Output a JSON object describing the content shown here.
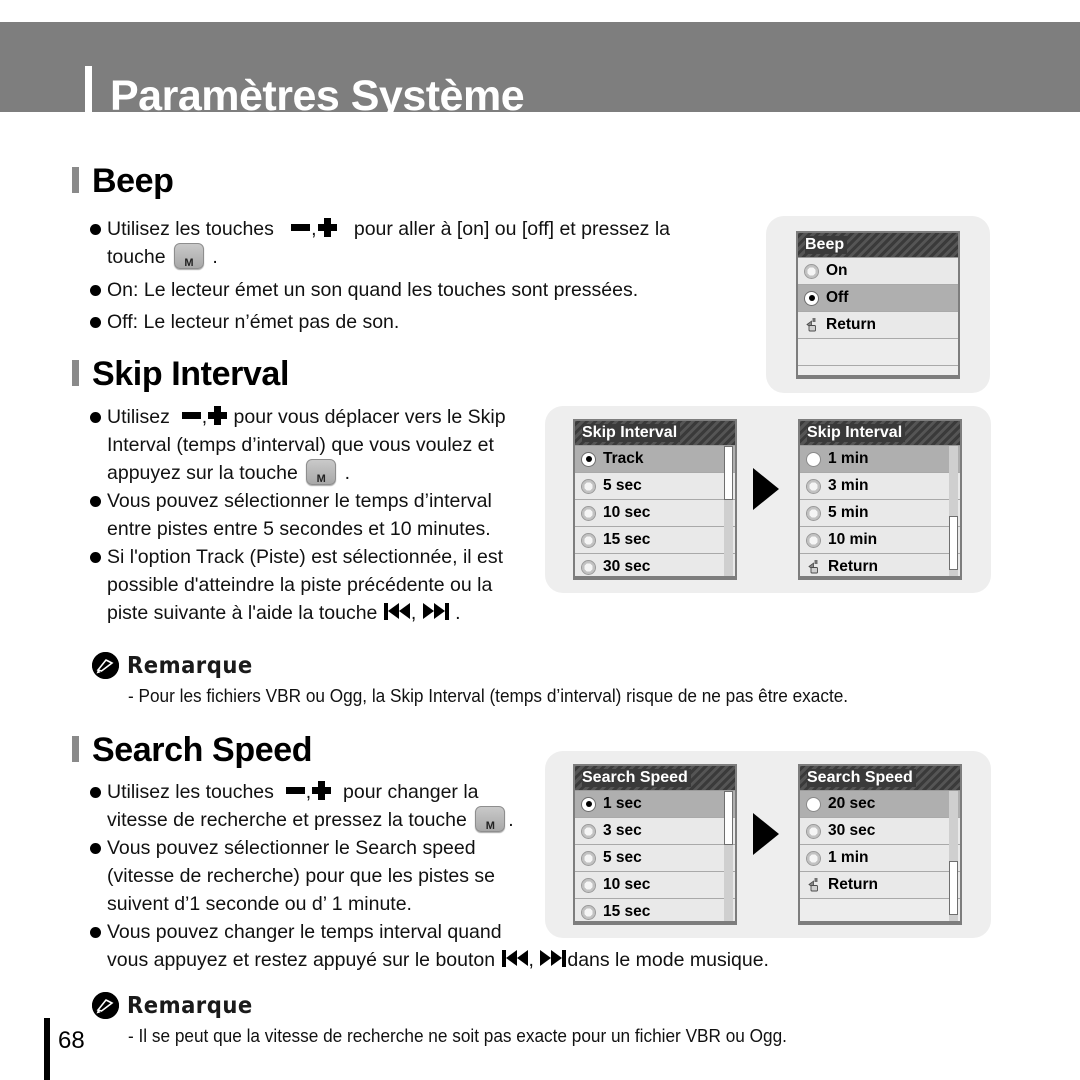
{
  "header": {
    "title": "Paramètres Système"
  },
  "sections": {
    "beep": {
      "heading": "Beep",
      "bullets": [
        {
          "pre": "Utilisez les touches",
          "mid": "pour aller à [on] ou [off] et pressez la",
          "post": "touche",
          "tail": "."
        },
        {
          "text": "On: Le lecteur émet un son quand les touches sont pressées."
        },
        {
          "text": "Off: Le lecteur n’émet pas de son."
        }
      ]
    },
    "skip_interval": {
      "heading": "Skip Interval",
      "bullets": [
        {
          "pre": "Utilisez",
          "mid": "pour vous déplacer vers le Skip",
          "line2": "Interval (temps d’interval) que vous voulez et",
          "line3pre": "appuyez sur la touche",
          "line3post": "."
        },
        {
          "text": "Vous pouvez sélectionner le temps d’interval",
          "line2": "entre pistes entre 5 secondes et 10 minutes."
        },
        {
          "text": "Si l'option Track (Piste) est sélectionnée, il est",
          "line2": "possible d'atteindre la piste précédente ou la",
          "line3pre": "piste suivante à l'aide la touche",
          "line3post": "."
        }
      ]
    },
    "search_speed": {
      "heading": "Search Speed",
      "bullets": [
        {
          "pre": "Utilisez les touches",
          "mid": "pour changer la",
          "line2pre": "vitesse de recherche et pressez la touche",
          "line2post": "."
        },
        {
          "text": "Vous pouvez sélectionner le Search speed",
          "line2": "(vitesse de recherche) pour que les pistes se",
          "line3": "suivent d’1 seconde ou d’ 1 minute."
        },
        {
          "text": "Vous pouvez changer le temps interval quand",
          "line2pre": "vous appuyez et restez appuyé sur le bouton",
          "line2post": "dans le mode musique."
        }
      ]
    }
  },
  "notes": [
    {
      "label": "Remarque",
      "body": "- Pour les fichiers VBR ou Ogg, la Skip Interval (temps d’interval) risque de ne pas être exacte."
    },
    {
      "label": "Remarque",
      "body": "- Il se peut que la vitesse de recherche ne soit pas exacte pour un fichier VBR ou Ogg."
    }
  ],
  "panels": {
    "beep": {
      "title": "Beep",
      "rows": [
        {
          "label": "On",
          "icon": "radio-off",
          "selected": false
        },
        {
          "label": "Off",
          "icon": "radio-on",
          "selected": true
        },
        {
          "label": "Return",
          "icon": "return-arrow",
          "selected": false
        },
        {
          "label": "",
          "icon": "none",
          "selected": false
        },
        {
          "label": "",
          "icon": "none",
          "selected": false
        }
      ],
      "scrollbar": false
    },
    "skip_interval_1": {
      "title": "Skip Interval",
      "rows": [
        {
          "label": "Track",
          "icon": "radio-on",
          "selected": true
        },
        {
          "label": "5 sec",
          "icon": "radio-off",
          "selected": false
        },
        {
          "label": "10 sec",
          "icon": "radio-off",
          "selected": false
        },
        {
          "label": "15 sec",
          "icon": "radio-off",
          "selected": false
        },
        {
          "label": "30 sec",
          "icon": "radio-off",
          "selected": false
        }
      ],
      "scrollbar": true,
      "thumb_top_pct": 0,
      "thumb_height_pct": 40
    },
    "skip_interval_2": {
      "title": "Skip Interval",
      "rows": [
        {
          "label": "1 min",
          "icon": "radio-plain",
          "selected": true
        },
        {
          "label": "3 min",
          "icon": "radio-off",
          "selected": false
        },
        {
          "label": "5 min",
          "icon": "radio-off",
          "selected": false
        },
        {
          "label": "10 min",
          "icon": "radio-off",
          "selected": false
        },
        {
          "label": "Return",
          "icon": "return-arrow",
          "selected": false
        }
      ],
      "scrollbar": true,
      "thumb_top_pct": 52,
      "thumb_height_pct": 40
    },
    "search_speed_1": {
      "title": "Search Speed",
      "rows": [
        {
          "label": "1 sec",
          "icon": "radio-on",
          "selected": true
        },
        {
          "label": "3 sec",
          "icon": "radio-off",
          "selected": false
        },
        {
          "label": "5 sec",
          "icon": "radio-off",
          "selected": false
        },
        {
          "label": "10 sec",
          "icon": "radio-off",
          "selected": false
        },
        {
          "label": "15 sec",
          "icon": "radio-off",
          "selected": false
        }
      ],
      "scrollbar": true,
      "thumb_top_pct": 0,
      "thumb_height_pct": 40
    },
    "search_speed_2": {
      "title": "Search Speed",
      "rows": [
        {
          "label": "20 sec",
          "icon": "radio-plain",
          "selected": true
        },
        {
          "label": "30 sec",
          "icon": "radio-off",
          "selected": false
        },
        {
          "label": "1 min",
          "icon": "radio-off",
          "selected": false
        },
        {
          "label": "Return",
          "icon": "return-arrow",
          "selected": false
        },
        {
          "label": "",
          "icon": "none",
          "selected": false
        }
      ],
      "scrollbar": true,
      "thumb_top_pct": 52,
      "thumb_height_pct": 40
    }
  },
  "footer": {
    "page_number": "68"
  },
  "icons": {
    "minus_key": "minus-key-icon",
    "plus_key": "plus-key-icon",
    "mode_key": "M",
    "prev_track": "prev-track-icon",
    "next_track": "next-track-icon"
  },
  "colors": {
    "header_bg": "#7e7e7e",
    "panel_group_bg": "#eeeeee",
    "lcd_bg": "#d6d6d6",
    "lcd_row_bg": "#e9e9e9",
    "lcd_row_selected_bg": "#afafaf",
    "lcd_title_bg": "#3a3a3a",
    "text": "#111111"
  }
}
